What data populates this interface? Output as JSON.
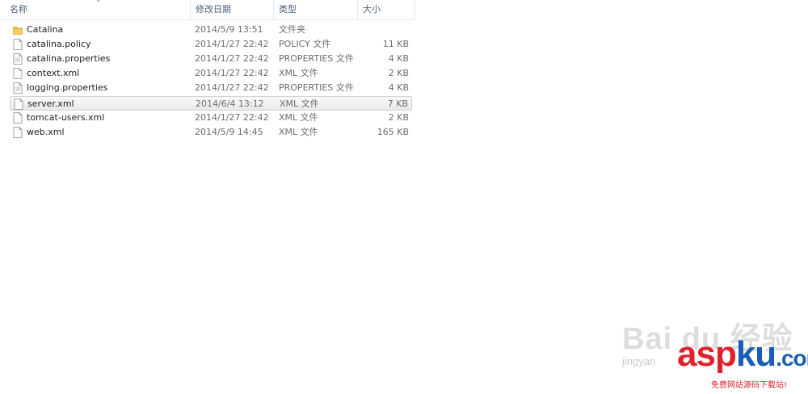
{
  "columns": {
    "name": "名称",
    "date": "修改日期",
    "type": "类型",
    "size": "大小"
  },
  "files": [
    {
      "name": "Catalina",
      "date": "2014/5/9 13:51",
      "type": "文件夹",
      "size": "",
      "icon": "folder-icon"
    },
    {
      "name": "catalina.policy",
      "date": "2014/1/27 22:42",
      "type": "POLICY 文件",
      "size": "11 KB",
      "icon": "file-icon"
    },
    {
      "name": "catalina.properties",
      "date": "2014/1/27 22:42",
      "type": "PROPERTIES 文件",
      "size": "4 KB",
      "icon": "file-icon"
    },
    {
      "name": "context.xml",
      "date": "2014/1/27 22:42",
      "type": "XML 文件",
      "size": "2 KB",
      "icon": "file-icon"
    },
    {
      "name": "logging.properties",
      "date": "2014/1/27 22:42",
      "type": "PROPERTIES 文件",
      "size": "4 KB",
      "icon": "file-icon"
    },
    {
      "name": "server.xml",
      "date": "2014/6/4 13:12",
      "type": "XML 文件",
      "size": "7 KB",
      "icon": "file-icon",
      "selected": true
    },
    {
      "name": "tomcat-users.xml",
      "date": "2014/1/27 22:42",
      "type": "XML 文件",
      "size": "2 KB",
      "icon": "file-icon"
    },
    {
      "name": "web.xml",
      "date": "2014/5/9 14:45",
      "type": "XML 文件",
      "size": "165 KB",
      "icon": "file-icon"
    }
  ],
  "watermark": {
    "baidu": "Bai du 经验",
    "jingyan": "jingyan",
    "asp": "asp",
    "ku": "ku",
    "com": ".com",
    "sub": "免费网站源码下载站!"
  }
}
